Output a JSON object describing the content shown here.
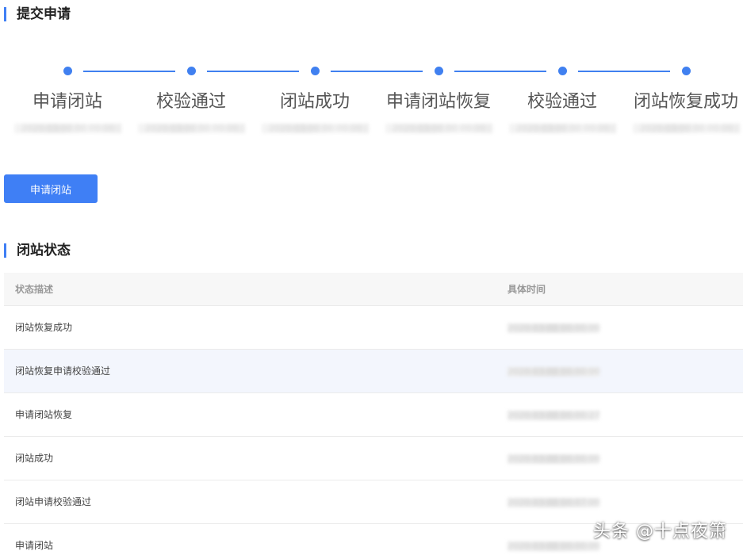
{
  "submit_section": {
    "title": "提交申请"
  },
  "steps": [
    {
      "label": "申请闭站",
      "time": "2020-03-00 00:00:00"
    },
    {
      "label": "校验通过",
      "time": "2020-03-00 00:00:00"
    },
    {
      "label": "闭站成功",
      "time": "2020-03-00 00:00:00"
    },
    {
      "label": "申请闭站恢复",
      "time": "2020-03-00 00:00:00"
    },
    {
      "label": "校验通过",
      "time": "2020-03-00 00:00:00"
    },
    {
      "label": "闭站恢复成功",
      "time": "2020-03-00 00:00:00"
    }
  ],
  "actions": {
    "apply_button": "申请闭站"
  },
  "status_section": {
    "title": "闭站状态"
  },
  "table": {
    "columns": [
      "状态描述",
      "具体时间"
    ],
    "rows": [
      {
        "desc": "闭站恢复成功",
        "time": "2020-03-00 00:00:00"
      },
      {
        "desc": "闭站恢复申请校验通过",
        "time": "2020-03-00 00:00:00"
      },
      {
        "desc": "申请闭站恢复",
        "time": "2020-03-00 00:00:27"
      },
      {
        "desc": "闭站成功",
        "time": "2020-03-00 00:00:00"
      },
      {
        "desc": "闭站申请校验通过",
        "time": "2020-03-00 00:07:00"
      },
      {
        "desc": "申请闭站",
        "time": "2020-03-00 00:00:00"
      }
    ]
  },
  "watermark": {
    "text": "头条 @十点夜箫"
  },
  "colors": {
    "accent": "#3f7ff5",
    "step": "#4080f0",
    "row_highlight": "#f3f6fd"
  }
}
